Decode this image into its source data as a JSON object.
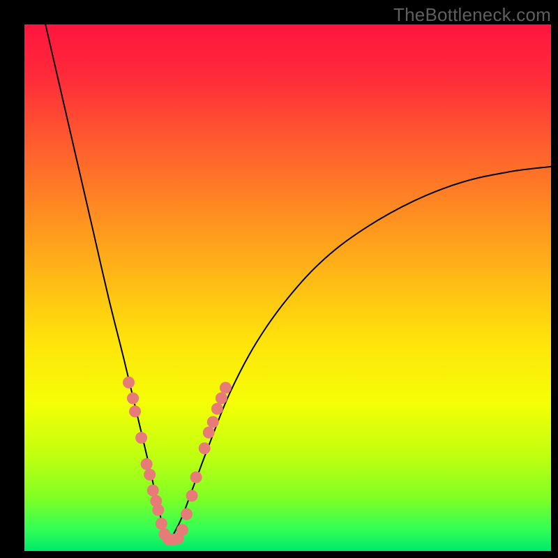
{
  "watermark": "TheBottleneck.com",
  "chart_data": {
    "type": "line",
    "title": "",
    "xlabel": "",
    "ylabel": "",
    "xlim": [
      0,
      1
    ],
    "ylim": [
      0,
      1
    ],
    "notes": "Gradient background runs red→orange→yellow→green top-to-bottom. A thin black V-shaped curve descends from top-left, bottoms near x≈0.27, and rises toward the right edge at ~0.72 height. Salmon-pink dots are scattered along the lower portion of both arms near the trough.",
    "curve": {
      "left_arm": [
        {
          "x": 0.04,
          "y": 1.0
        },
        {
          "x": 0.07,
          "y": 0.87
        },
        {
          "x": 0.1,
          "y": 0.74
        },
        {
          "x": 0.13,
          "y": 0.61
        },
        {
          "x": 0.16,
          "y": 0.48
        },
        {
          "x": 0.19,
          "y": 0.36
        },
        {
          "x": 0.215,
          "y": 0.255
        },
        {
          "x": 0.235,
          "y": 0.17
        },
        {
          "x": 0.252,
          "y": 0.095
        },
        {
          "x": 0.262,
          "y": 0.05
        },
        {
          "x": 0.272,
          "y": 0.02
        }
      ],
      "right_arm": [
        {
          "x": 0.272,
          "y": 0.02
        },
        {
          "x": 0.295,
          "y": 0.055
        },
        {
          "x": 0.32,
          "y": 0.12
        },
        {
          "x": 0.35,
          "y": 0.2
        },
        {
          "x": 0.39,
          "y": 0.3
        },
        {
          "x": 0.44,
          "y": 0.395
        },
        {
          "x": 0.5,
          "y": 0.48
        },
        {
          "x": 0.57,
          "y": 0.555
        },
        {
          "x": 0.65,
          "y": 0.615
        },
        {
          "x": 0.74,
          "y": 0.665
        },
        {
          "x": 0.83,
          "y": 0.7
        },
        {
          "x": 0.92,
          "y": 0.72
        },
        {
          "x": 1.0,
          "y": 0.73
        }
      ]
    },
    "dots": [
      {
        "x": 0.198,
        "y": 0.32
      },
      {
        "x": 0.206,
        "y": 0.29
      },
      {
        "x": 0.21,
        "y": 0.265
      },
      {
        "x": 0.222,
        "y": 0.215
      },
      {
        "x": 0.232,
        "y": 0.165
      },
      {
        "x": 0.238,
        "y": 0.145
      },
      {
        "x": 0.244,
        "y": 0.115
      },
      {
        "x": 0.25,
        "y": 0.095
      },
      {
        "x": 0.254,
        "y": 0.078
      },
      {
        "x": 0.26,
        "y": 0.052
      },
      {
        "x": 0.266,
        "y": 0.032
      },
      {
        "x": 0.274,
        "y": 0.022
      },
      {
        "x": 0.282,
        "y": 0.022
      },
      {
        "x": 0.292,
        "y": 0.024
      },
      {
        "x": 0.3,
        "y": 0.04
      },
      {
        "x": 0.308,
        "y": 0.07
      },
      {
        "x": 0.318,
        "y": 0.105
      },
      {
        "x": 0.326,
        "y": 0.14
      },
      {
        "x": 0.342,
        "y": 0.195
      },
      {
        "x": 0.35,
        "y": 0.225
      },
      {
        "x": 0.358,
        "y": 0.245
      },
      {
        "x": 0.366,
        "y": 0.27
      },
      {
        "x": 0.374,
        "y": 0.29
      },
      {
        "x": 0.382,
        "y": 0.31
      }
    ],
    "gradient_stops": [
      {
        "offset": 0.0,
        "color": "#ff153f"
      },
      {
        "offset": 0.1,
        "color": "#ff2b3a"
      },
      {
        "offset": 0.22,
        "color": "#ff5a2e"
      },
      {
        "offset": 0.35,
        "color": "#ff8a22"
      },
      {
        "offset": 0.48,
        "color": "#ffb916"
      },
      {
        "offset": 0.6,
        "color": "#ffe30b"
      },
      {
        "offset": 0.72,
        "color": "#f4ff05"
      },
      {
        "offset": 0.82,
        "color": "#c0ff10"
      },
      {
        "offset": 0.9,
        "color": "#7fff25"
      },
      {
        "offset": 0.96,
        "color": "#30ff55"
      },
      {
        "offset": 1.0,
        "color": "#00e86a"
      }
    ],
    "dot_color": "#e77b78",
    "curve_color": "#000000"
  }
}
